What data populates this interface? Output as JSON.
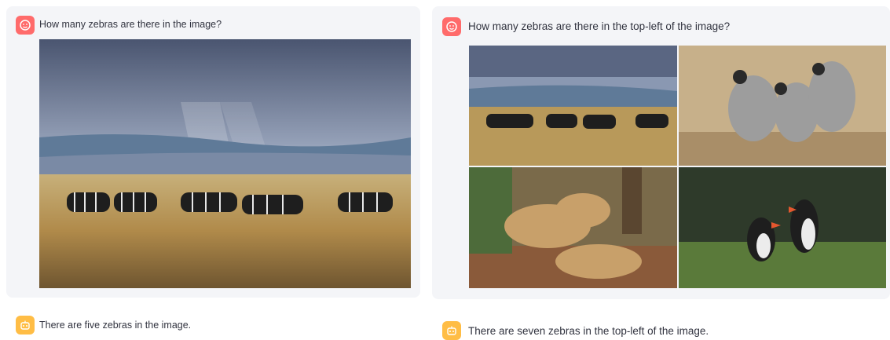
{
  "left_pane": {
    "user_message": {
      "avatar_icon": "user-face-icon",
      "avatar_color": "#ff6b6b",
      "text": "How many zebras are there in the image?"
    },
    "image_content": "zebras-savanna-photo",
    "assistant_message": {
      "avatar_icon": "robot-icon",
      "avatar_color": "#ffbd45",
      "text": "There are five zebras in the image."
    }
  },
  "right_pane": {
    "user_message": {
      "avatar_icon": "user-face-icon",
      "avatar_color": "#ff6b6b",
      "text": "How many zebras are there in the top-left of the image?"
    },
    "image_grid": [
      "zebras-savanna-photo",
      "langurs-photo",
      "lions-photo",
      "puffins-photo"
    ],
    "assistant_message": {
      "avatar_icon": "robot-icon",
      "avatar_color": "#ffbd45",
      "text": "There are seven zebras in the top-left of the image."
    }
  }
}
